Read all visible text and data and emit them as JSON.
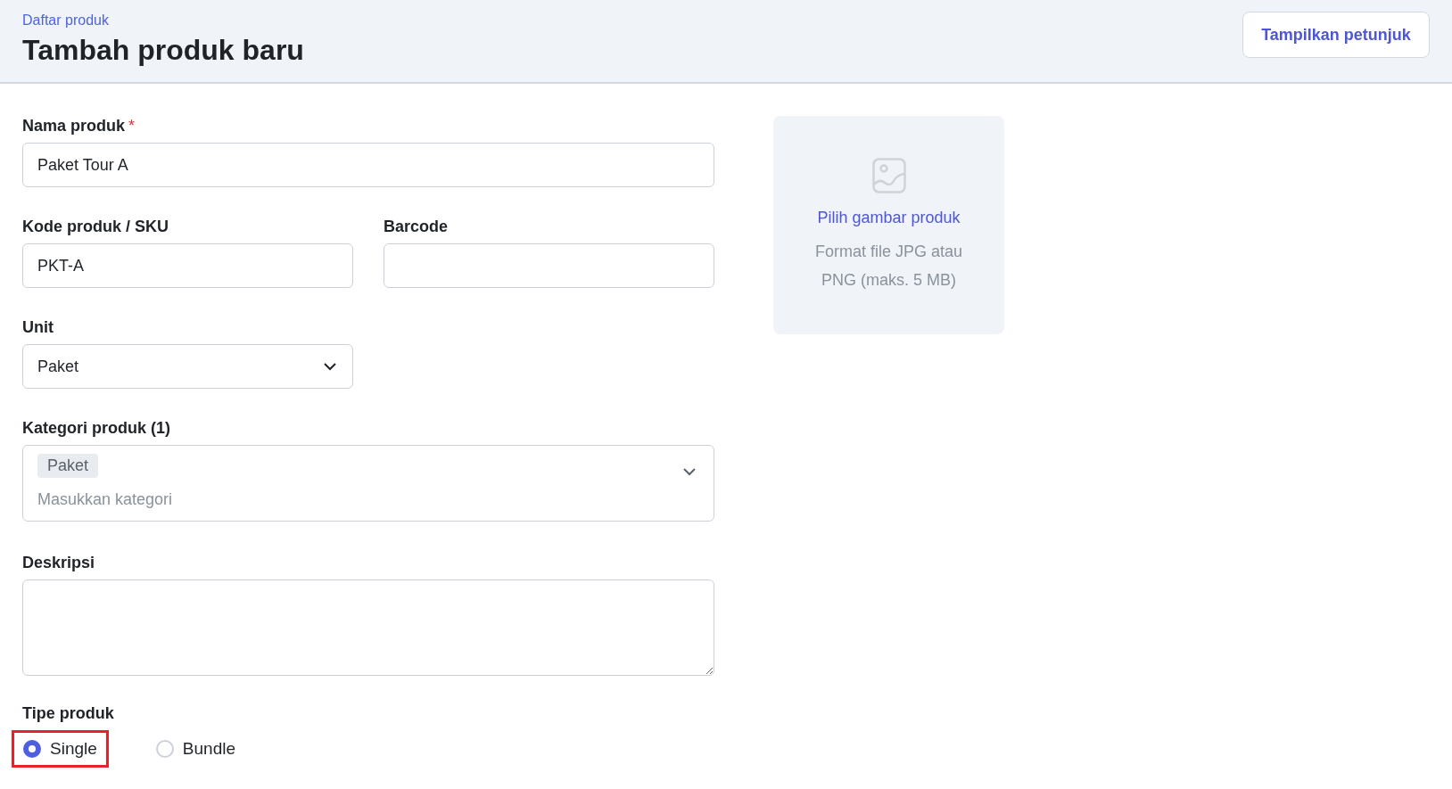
{
  "header": {
    "breadcrumb": "Daftar produk",
    "title": "Tambah produk baru",
    "help_button": "Tampilkan petunjuk"
  },
  "form": {
    "name": {
      "label": "Nama produk",
      "required_mark": "*",
      "value": "Paket Tour A"
    },
    "sku": {
      "label": "Kode produk / SKU",
      "value": "PKT-A"
    },
    "barcode": {
      "label": "Barcode"
    },
    "unit": {
      "label": "Unit",
      "value": "Paket"
    },
    "category": {
      "label": "Kategori produk (1)",
      "tags": [
        "Paket"
      ],
      "placeholder": "Masukkan kategori"
    },
    "description": {
      "label": "Deskripsi"
    },
    "product_type": {
      "label": "Tipe produk",
      "options": [
        {
          "label": "Single",
          "selected": true,
          "highlighted": true
        },
        {
          "label": "Bundle",
          "selected": false,
          "highlighted": false
        }
      ]
    }
  },
  "image_upload": {
    "link": "Pilih gambar produk",
    "hint": "Format file JPG atau PNG (maks. 5 MB)"
  }
}
